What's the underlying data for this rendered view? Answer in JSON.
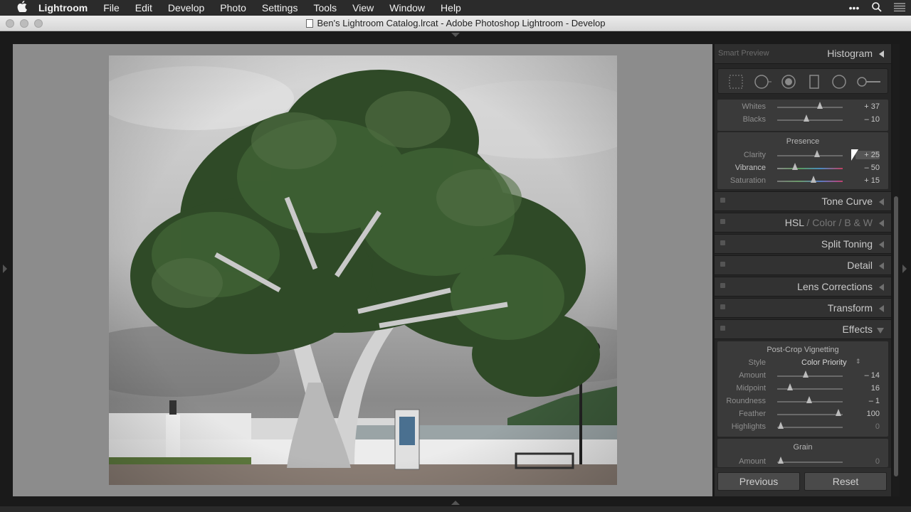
{
  "menubar": {
    "apple": "",
    "app": "Lightroom",
    "items": [
      "File",
      "Edit",
      "Develop",
      "Photo",
      "Settings",
      "Tools",
      "View",
      "Window",
      "Help"
    ],
    "right_icons": [
      "more-icon",
      "search-icon",
      "list-icon"
    ]
  },
  "window": {
    "title": "Ben's Lightroom Catalog.lrcat - Adobe Photoshop Lightroom - Develop"
  },
  "panel": {
    "smart_preview": "Smart Preview",
    "histogram": "Histogram",
    "tools": [
      "crop-overlay-icon",
      "spot-removal-icon",
      "red-eye-icon",
      "graduated-filter-icon",
      "radial-filter-icon",
      "adjustment-brush-icon"
    ],
    "basic_tail": [
      {
        "label": "Whites",
        "value": "+ 37",
        "pos": 0.67
      },
      {
        "label": "Blacks",
        "value": "– 10",
        "pos": 0.45
      }
    ],
    "presence": {
      "title": "Presence",
      "sliders": [
        {
          "label": "Clarity",
          "value": "+ 25",
          "pos": 0.62
        },
        {
          "label": "Vibrance",
          "value": "– 50",
          "pos": 0.28
        },
        {
          "label": "Saturation",
          "value": "+ 15",
          "pos": 0.58
        }
      ]
    },
    "collapsed": [
      {
        "name": "Tone Curve"
      },
      {
        "name": "HSL",
        "extra1": "Color",
        "extra2": "B & W",
        "sep": "/"
      },
      {
        "name": "Split Toning"
      },
      {
        "name": "Detail"
      },
      {
        "name": "Lens Corrections"
      },
      {
        "name": "Transform"
      }
    ],
    "effects": {
      "name": "Effects",
      "vignette_title": "Post-Crop Vignetting",
      "style_label": "Style",
      "style_value": "Color Priority",
      "sliders": [
        {
          "label": "Amount",
          "value": "– 14",
          "pos": 0.43
        },
        {
          "label": "Midpoint",
          "value": "16",
          "pos": 0.2
        },
        {
          "label": "Roundness",
          "value": "– 1",
          "pos": 0.5
        },
        {
          "label": "Feather",
          "value": "100",
          "pos": 0.95
        },
        {
          "label": "Highlights",
          "value": "0",
          "pos": 0.06
        }
      ],
      "grain_title": "Grain",
      "grain": [
        {
          "label": "Amount",
          "value": "0",
          "pos": 0.06
        }
      ]
    },
    "buttons": {
      "previous": "Previous",
      "reset": "Reset"
    }
  }
}
